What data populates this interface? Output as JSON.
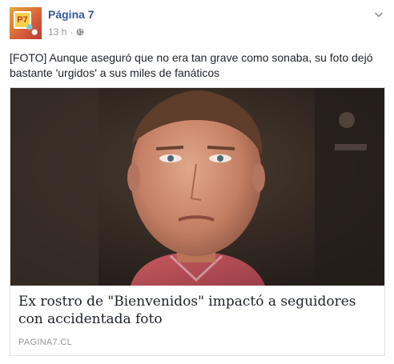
{
  "post": {
    "page_name": "Página 7",
    "time": "13 h",
    "separator": "·",
    "audience_icon": "globe-icon",
    "menu_icon": "chevron-down-icon",
    "text": "[FOTO] Aunque aseguró que no era tan grave como sonaba, su foto dejó bastante 'urgidos' a sus miles de fanáticos"
  },
  "avatar": {
    "logo_text": "P7"
  },
  "link": {
    "title": "Ex rostro de \"Bienvenidos\" impactó a seguidores con accidentada foto",
    "domain": "PAGINA7.CL"
  },
  "colors": {
    "link_blue": "#365899",
    "meta_gray": "#90949c",
    "text": "#1d2129",
    "border": "#dddfe2"
  }
}
